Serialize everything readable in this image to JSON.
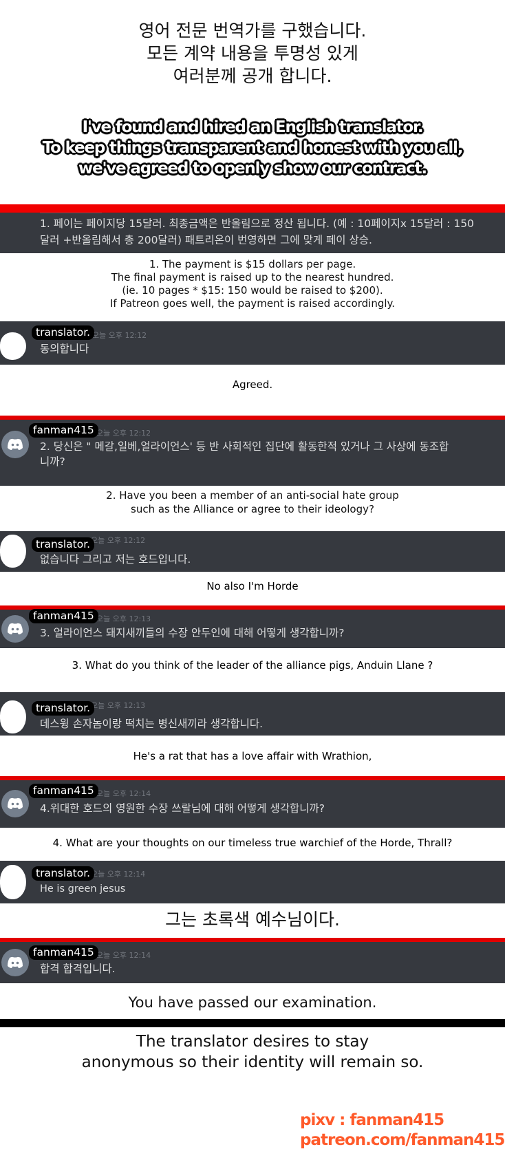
{
  "header": {
    "korean_lines": [
      "영어 전문 번역가를 구했습니다.",
      "모든 계약 내용을 투명성 있게",
      "여러분께 공개 합니다."
    ],
    "english_lines": [
      "I've found and hired an English translator.",
      "To keep things transparent and honest with you all,",
      "we've agreed to openly show our contract."
    ]
  },
  "colors": {
    "accent_red": "#f10000",
    "discord_dark": "#36393f",
    "credit_orange": "#ff5a2a",
    "discord_avatar_gray": "#747f8d"
  },
  "sections": [
    {
      "korean_lines": [
        "1. 페이는 페이지당 15달러. 최종금액은 반올림으로 정산 됩니다. (예 : 10페이지x 15달러 : 150",
        "달러 +반올림해서 총 200달러) 패트리온이 번영하면 그에 맞게 페이 상승."
      ],
      "english_lines": [
        "1. The payment is $15 dollars per page.",
        "The final payment is raised up to the nearest hundred.",
        "(ie. 10 pages * $15: 150 would be raised to $200).",
        "If Patreon goes well, the payment is raised accordingly."
      ]
    }
  ],
  "messages": [
    {
      "author": "translator.",
      "avatar": "blank-avatar",
      "timestamp": "오늘 오후 12:12",
      "text": "동의합니다",
      "translation": "Agreed."
    },
    {
      "author": "fanman415",
      "avatar": "discord-avatar",
      "timestamp": "오늘 오후 12:12",
      "text_lines": [
        "2. 당신은 \" 메갈,일베,얼라이언스' 등 반 사회적인 집단에 활동한적 있거나 그 사상에 동조합",
        "니까?"
      ],
      "translation_lines": [
        "2. Have you been a member of an anti-social hate group",
        "such as the Alliance or agree to their ideology?"
      ]
    },
    {
      "author": "translator.",
      "avatar": "blank-avatar",
      "timestamp": "오늘 오후 12:12",
      "text": "없습니다 그리고 저는 호드입니다.",
      "translation": "No also I'm Horde"
    },
    {
      "author": "fanman415",
      "avatar": "discord-avatar",
      "timestamp": "오늘 오후 12:13",
      "text": "3. 얼라이언스 돼지새끼들의 수장 안두인에 대해 어떻게 생각합니까?",
      "translation": "3. What do you think of the leader of the alliance pigs, Anduin Llane ?"
    },
    {
      "author": "translator.",
      "avatar": "blank-avatar",
      "timestamp": "오늘 오후 12:13",
      "text": "데스윙 손자놈이랑 떡치는 병신새끼라 생각합니다.",
      "translation": "He's a rat that has a love affair with  Wrathion,"
    },
    {
      "author": "fanman415",
      "avatar": "discord-avatar",
      "timestamp": "오늘 오후 12:14",
      "text": "4.위대한 호드의 영원한 수장 쓰랄님에 대해 어떻게 생각합니까?",
      "translation": "4. What are your thoughts on our timeless true warchief of the Horde, Thrall?"
    },
    {
      "author": "translator.",
      "avatar": "blank-avatar",
      "timestamp": "오늘 오후 12:14",
      "text": "He is green jesus",
      "translation": "그는 초록색 예수님이다."
    },
    {
      "author": "fanman415",
      "avatar": "discord-avatar",
      "timestamp": "오늘 오후 12:14",
      "text": "합격 합격입니다.",
      "translation": "You have passed our examination."
    }
  ],
  "footer": {
    "note_lines": [
      "The translator desires to stay",
      "anonymous so their identity will remain so."
    ],
    "credit_lines": [
      "pixv : fanman415",
      "patreon.com/fanman415"
    ]
  }
}
